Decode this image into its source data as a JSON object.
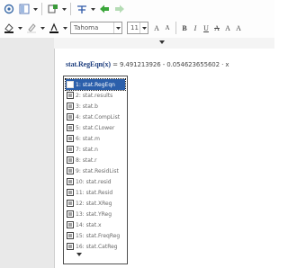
{
  "toolbar": {
    "font_name": "Tahoma",
    "font_size": "11",
    "grow_font": "A",
    "shrink_font": "A",
    "bold": "B",
    "italic": "I",
    "underline": "U",
    "strike": "A",
    "subscript": "A",
    "superscript": "A"
  },
  "document": {
    "func_name": "stat.RegEqn(x)",
    "equation": " = 9.491213926 - 0.054623655602 · x"
  },
  "menu": {
    "items": [
      {
        "label": "1: stat.RegEqn",
        "icon": "list-icon"
      },
      {
        "label": "2: stat.results",
        "icon": "list-icon"
      },
      {
        "label": "3: stat.b",
        "icon": "list-icon"
      },
      {
        "label": "4: stat.CompList",
        "icon": "list-icon"
      },
      {
        "label": "5: stat.CLower",
        "icon": "list-icon"
      },
      {
        "label": "6: stat.m",
        "icon": "list-icon"
      },
      {
        "label": "7: stat.n",
        "icon": "list-icon"
      },
      {
        "label": "8: stat.r",
        "icon": "list-icon"
      },
      {
        "label": "9: stat.ResidList",
        "icon": "list-icon"
      },
      {
        "label": "10: stat.resid",
        "icon": "list-icon"
      },
      {
        "label": "11: stat.Resid",
        "icon": "list-icon"
      },
      {
        "label": "12: stat.XReg",
        "icon": "list-icon"
      },
      {
        "label": "13: stat.YReg",
        "icon": "list-icon"
      },
      {
        "label": "14: stat.x",
        "icon": "list-icon"
      },
      {
        "label": "15: stat.FreqReg",
        "icon": "list-icon"
      },
      {
        "label": "16: stat.CatReg",
        "icon": "list-icon"
      }
    ]
  },
  "colors": {
    "selection": "#2b5fab",
    "accent": "#3a9a3a"
  }
}
